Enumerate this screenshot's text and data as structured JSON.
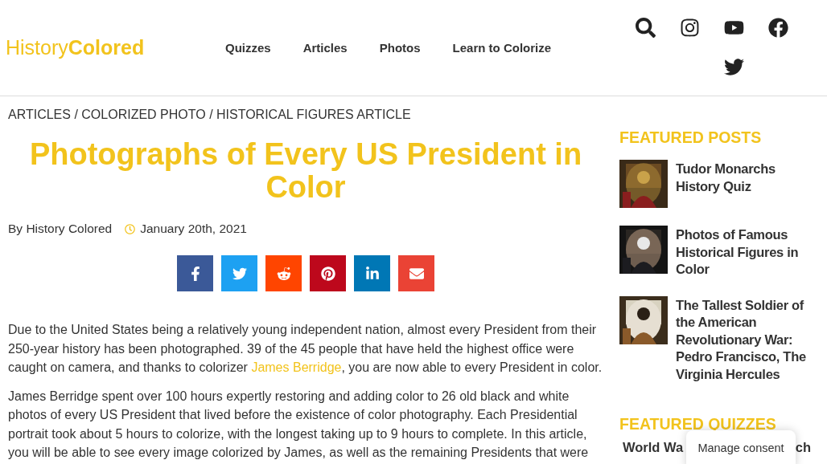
{
  "header": {
    "logo": {
      "light": "History",
      "bold": "Colored"
    },
    "nav": [
      "Quizzes",
      "Articles",
      "Photos",
      "Learn to Colorize"
    ],
    "social_icons": [
      {
        "kind": "search"
      },
      {
        "kind": "instagram"
      },
      {
        "kind": "youtube"
      },
      {
        "kind": "facebook"
      },
      {
        "kind": "twitter"
      }
    ]
  },
  "breadcrumb": "ARTICLES / COLORIZED PHOTO / HISTORICAL FIGURES ARTICLE",
  "article": {
    "title": "Photographs of Every US President in Color",
    "author": "By History Colored",
    "date": "January 20th, 2021",
    "share_buttons": [
      {
        "kind": "facebook",
        "color": "#3b5998"
      },
      {
        "kind": "twitter",
        "color": "#1da1f2"
      },
      {
        "kind": "reddit",
        "color": "#ff4500"
      },
      {
        "kind": "pinterest",
        "color": "#bd081c"
      },
      {
        "kind": "linkedin",
        "color": "#0077b5"
      },
      {
        "kind": "email",
        "color": "#ea4335"
      }
    ],
    "paragraphs": [
      {
        "before": "Due to the United States being a relatively young independent nation, almost every President from their 250-year history has been photographed. 39 of the 45 people that have held the highest office were caught on camera, and thanks to colorizer ",
        "link": "James Berridge",
        "after": ", you are now able to every President in color."
      },
      {
        "before": "James Berridge spent over 100 hours expertly restoring and adding color to 26 old black and white photos of every US President that lived before the existence of color photography. Each Presidential portrait took about 5 hours to colorize, with the longest taking up to 9 hours to complete. In this article, you will be able to see every image colorized by James, as well as the remaining Presidents that were"
      }
    ]
  },
  "sidebar": {
    "featured_posts_heading": "FEATURED POSTS",
    "featured_posts": [
      {
        "title": "Tudor Monarchs History Quiz"
      },
      {
        "title": "Photos of Famous Historical Figures in Color"
      },
      {
        "title": "The Tallest Soldier of the American Revolutionary War: Pedro Francisco, The Virginia Hercules"
      }
    ],
    "featured_quizzes_heading": "FEATURED QUIZZES",
    "featured_quiz_title_start": "World Wa",
    "featured_quiz_title_end": "ch"
  },
  "consent_button": "Manage consent"
}
